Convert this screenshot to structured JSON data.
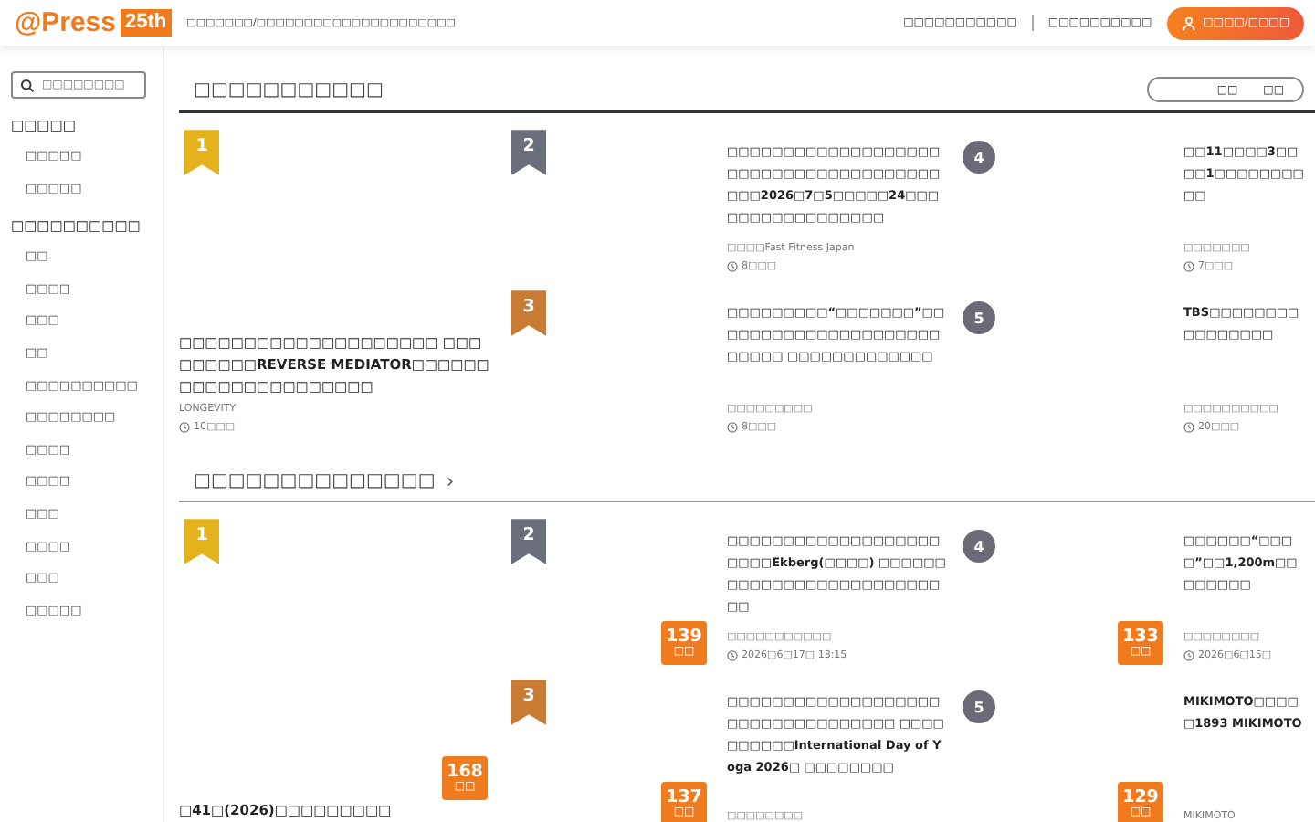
{
  "header": {
    "logo": "@Press",
    "anniversary": "25th",
    "tagline": "□□□□□□□/□□□□□□□□□□□□□□□□□□□□□",
    "links": [
      "□□□□□□□□□□□",
      "□□□□□□□□□□"
    ],
    "login_button": "□□□□/□□□□"
  },
  "sidebar": {
    "search": {
      "placeholder": "□□□□□□□□"
    },
    "groups": [
      {
        "title": "□□□□□",
        "items": [
          "□□□□□",
          "□□□□□"
        ]
      },
      {
        "title": "□□□□□□□□□□",
        "items": [
          "□□",
          "□□□□",
          "□□□",
          "□□",
          "□□□□□□□□□□",
          "□□□□□□□□",
          "□□□□",
          "□□□□",
          "□□□",
          "□□□□",
          "□□□",
          "□□□□□"
        ]
      }
    ]
  },
  "sections": [
    {
      "title": "□□□□□□□□□□□",
      "toggle": [
        "□□",
        "□□"
      ],
      "items": [
        {
          "rank": "1",
          "kind": "ribbon",
          "color": "#e3b21c",
          "title": "□□□□□□□□□□□□□□□□□□□□ □□□□□□□□□REVERSE MEDIATOR□□□□□□□□□□□□□□□□□□□□□",
          "source": "LONGEVITY",
          "time": "10□□□"
        },
        {
          "rank": "2",
          "kind": "ribbon",
          "color": "#6b6f7b",
          "title": "□□□□□□□□□□□□□□□□□□□□□□□□□□□□□□□□□□□□□□□□□2026□7□5□□□□□24□□□□□□□□□□□□□□□□□",
          "source": "□□□□Fast Fitness Japan",
          "time": "8□□□"
        },
        {
          "rank": "3",
          "kind": "ribbon",
          "color": "#c97b34",
          "title": "□□□□□□□□□“□□□□□□□”□□□□□□□□□□□□□□□□□□□□□□□□□□ □□□□□□□□□□□□□",
          "source": "□□□□□□□□□",
          "time": "8□□□"
        },
        {
          "rank": "4",
          "kind": "circle",
          "color": "#6b6b78",
          "title": "□□11□□□□3□□□□1□□□□□□□□□□",
          "source": "□□□□□□□",
          "time": "7□□□"
        },
        {
          "rank": "5",
          "kind": "circle",
          "color": "#6b6b78",
          "title": "TBS□□□□□□□□□□□□□□□□",
          "source": "□□□□□□□□□□",
          "time": "20□□□"
        }
      ]
    },
    {
      "title": "□□□□□□□□□□□□□□",
      "link_icon": "›",
      "items": [
        {
          "rank": "1",
          "kind": "ribbon",
          "color": "#e3b21c",
          "title": "□41□(2026)□□□□□□□□□",
          "views": {
            "count": "168",
            "label": "□□"
          }
        },
        {
          "rank": "2",
          "kind": "ribbon",
          "color": "#6b6f7b",
          "title": "□□□□□□□□□□□□□□□□□□□□□□□Ekberg(□□□□) □□□□□□□□□□□□□□□□□□□□□□□□□□□",
          "source": "□□□□□□□□□□□",
          "time": "2026□6□17□ 13:15",
          "views": {
            "count": "139",
            "label": "□□"
          }
        },
        {
          "rank": "3",
          "kind": "ribbon",
          "color": "#c97b34",
          "title": "□□□□□□□□□□□□□□□□□□□□□□□□□□□□□□□□□□ □□□□□□□□□□International Day of Yoga 2026□ □□□□□□□□",
          "source": "□□□□□□□□",
          "views": {
            "count": "137",
            "label": "□□"
          }
        },
        {
          "rank": "4",
          "kind": "circle",
          "color": "#6b6b78",
          "title": "□□□□□□“□□□□”□□1,200m□□□□□□□□",
          "source": "□□□□□□□□",
          "time": "2026□6□15□",
          "views": {
            "count": "133",
            "label": "□□"
          }
        },
        {
          "rank": "5",
          "kind": "circle",
          "color": "#6b6b78",
          "title": "MIKIMOTO□□□□□1893 MIKIMOTO",
          "source": "MIKIMOTO",
          "views": {
            "count": "129",
            "label": "□□"
          }
        }
      ]
    }
  ]
}
